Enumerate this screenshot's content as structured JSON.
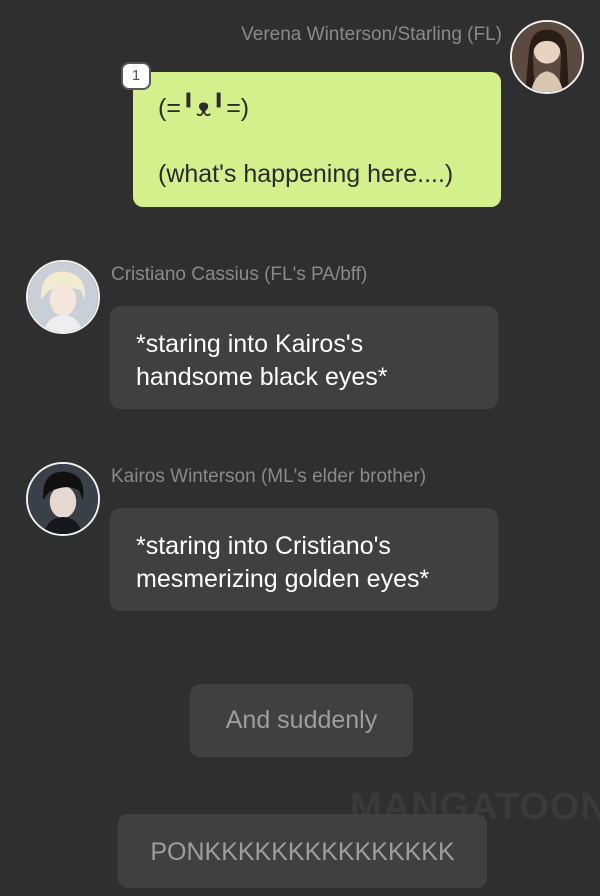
{
  "messages": [
    {
      "sender": "Verena Winterson/Starling (FL)",
      "text": "(=╹ᴥ╹=)\n\n(what's happening here....)",
      "badge": "1",
      "bubble_color": "#d4f08d"
    },
    {
      "sender": "Cristiano Cassius (FL's PA/bff)",
      "text": "*staring into Kairos's\nhandsome black eyes*",
      "bubble_color": "#404040"
    },
    {
      "sender": "Kairos Winterson (ML's elder brother)",
      "text": "*staring into Cristiano's\nmesmerizing golden eyes*",
      "bubble_color": "#404040"
    }
  ],
  "narrations": [
    "And suddenly",
    "PONKKKKKKKKKKKKKKK"
  ],
  "watermark": "MANGATOON",
  "colors": {
    "background": "#2f2f2f",
    "name_text": "#8a8a8a",
    "narration_text": "#9e9e9e"
  }
}
